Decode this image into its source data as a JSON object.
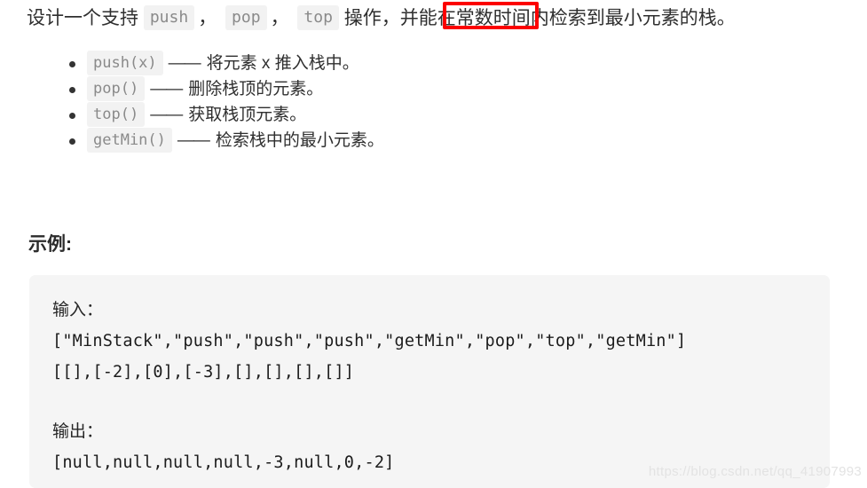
{
  "intro": {
    "lead": "设计一个支持",
    "codes": [
      "push",
      "pop",
      "top"
    ],
    "separator": "，",
    "middle": "操作，并能在",
    "highlight": "常数时间内",
    "tail": "检索到最小元素的栈。"
  },
  "bullets": [
    {
      "code": "push(x)",
      "dash": "——",
      "text": "将元素 x 推入栈中。"
    },
    {
      "code": "pop()",
      "dash": "——",
      "text": "删除栈顶的元素。"
    },
    {
      "code": "top()",
      "dash": "——",
      "text": "获取栈顶元素。"
    },
    {
      "code": "getMin()",
      "dash": "——",
      "text": "检索栈中的最小元素。"
    }
  ],
  "example": {
    "heading": "示例:",
    "input_label": "输入：",
    "input_lines": [
      "[\"MinStack\",\"push\",\"push\",\"push\",\"getMin\",\"pop\",\"top\",\"getMin\"]",
      "[[],[-2],[0],[-3],[],[],[],[]]"
    ],
    "output_label": "输出：",
    "output_lines": [
      "[null,null,null,null,-3,null,0,-2]"
    ]
  },
  "annotation": {
    "color": "#fc0000"
  },
  "watermark": {
    "text": "https://blog.csdn.net/qq_41907993"
  }
}
